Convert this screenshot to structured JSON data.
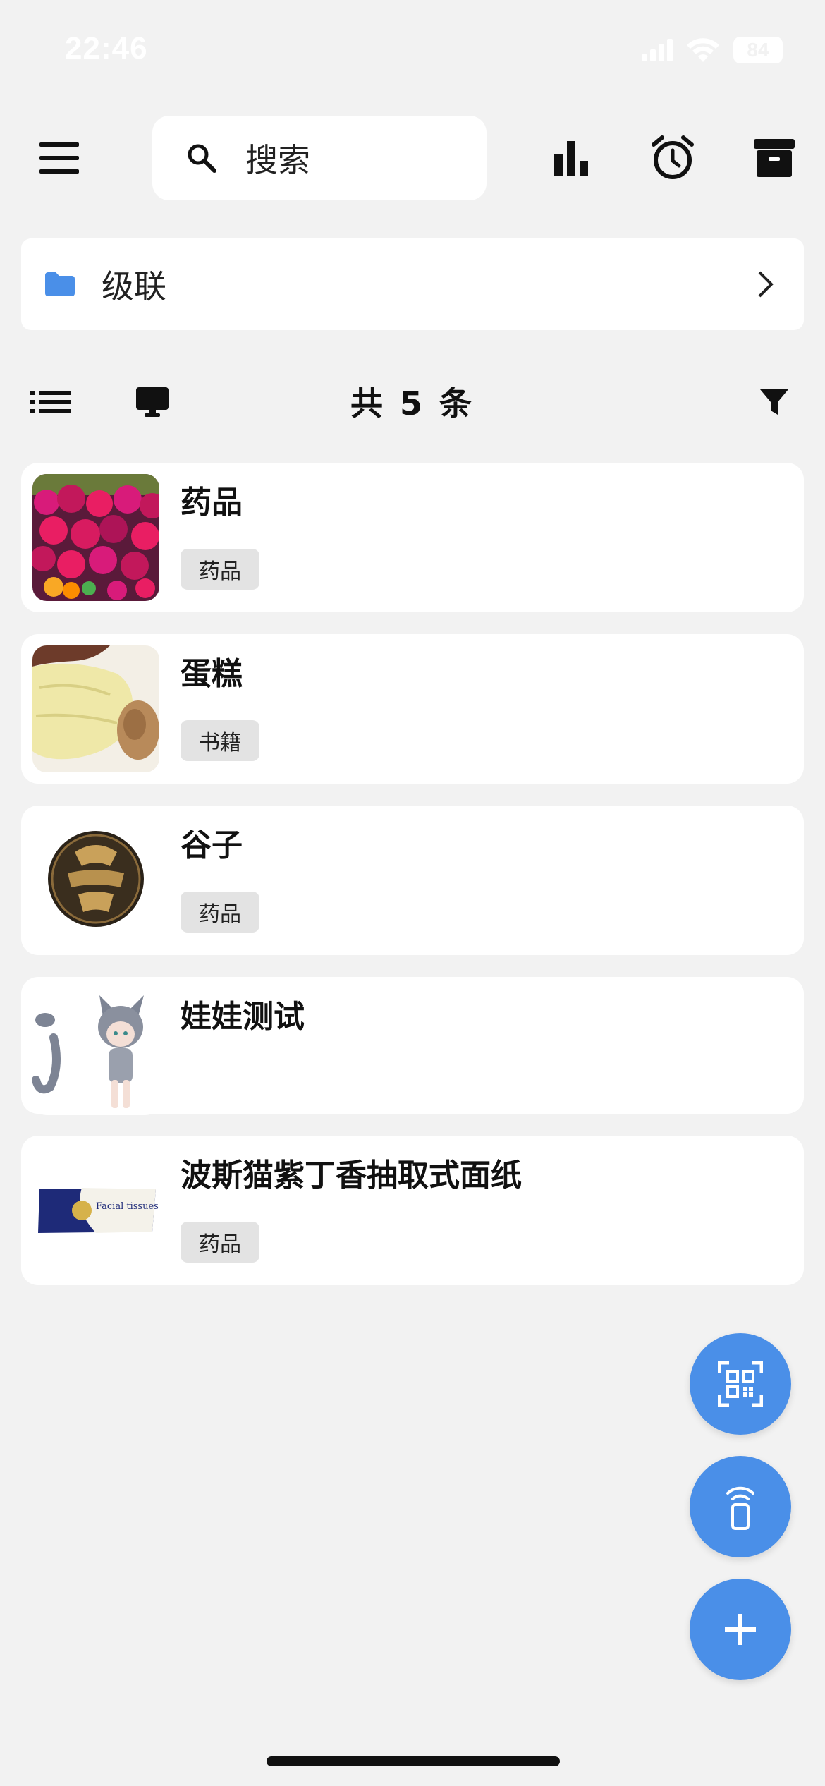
{
  "status_bar": {
    "time": "22:46",
    "battery": "84"
  },
  "toolbar": {
    "search_placeholder": "搜索"
  },
  "folder": {
    "label": "级联"
  },
  "list_header": {
    "count_text": "共 5 条"
  },
  "items": [
    {
      "title": "药品",
      "tag": "药品"
    },
    {
      "title": "蛋糕",
      "tag": "书籍"
    },
    {
      "title": "谷子",
      "tag": "药品"
    },
    {
      "title": "娃娃测试",
      "tag": ""
    },
    {
      "title": "波斯猫紫丁香抽取式面纸",
      "tag": "药品",
      "thumb_text": "Facial tissues"
    }
  ],
  "colors": {
    "accent": "#4a8fe8",
    "background": "#f2f2f2",
    "card": "#ffffff",
    "tag_bg": "#e3e3e3"
  }
}
